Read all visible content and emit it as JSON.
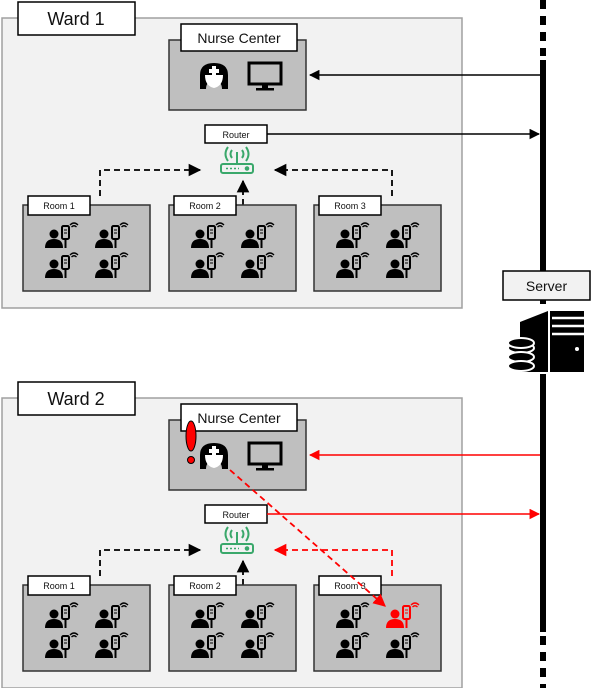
{
  "server": {
    "label": "Server"
  },
  "colors": {
    "alert": "#ff0000",
    "router": "#3aa86b",
    "ward_bg": "#f2f2f2",
    "room_bg": "#bfbfbf"
  },
  "wards": [
    {
      "title": "Ward 1",
      "nurse_center": "Nurse Center",
      "router": "Router",
      "alert": false,
      "rooms": [
        {
          "label": "Room 1",
          "alert_patient": -1
        },
        {
          "label": "Room 2",
          "alert_patient": -1
        },
        {
          "label": "Room 3",
          "alert_patient": -1
        }
      ]
    },
    {
      "title": "Ward 2",
      "nurse_center": "Nurse Center",
      "router": "Router",
      "alert": true,
      "rooms": [
        {
          "label": "Room 1",
          "alert_patient": -1
        },
        {
          "label": "Room 2",
          "alert_patient": -1
        },
        {
          "label": "Room 3",
          "alert_patient": 1
        }
      ]
    }
  ],
  "icons": [
    "nurse-icon",
    "monitor-icon",
    "router-icon",
    "patient-iv-icon",
    "server-icon",
    "database-icon",
    "alert-icon"
  ]
}
